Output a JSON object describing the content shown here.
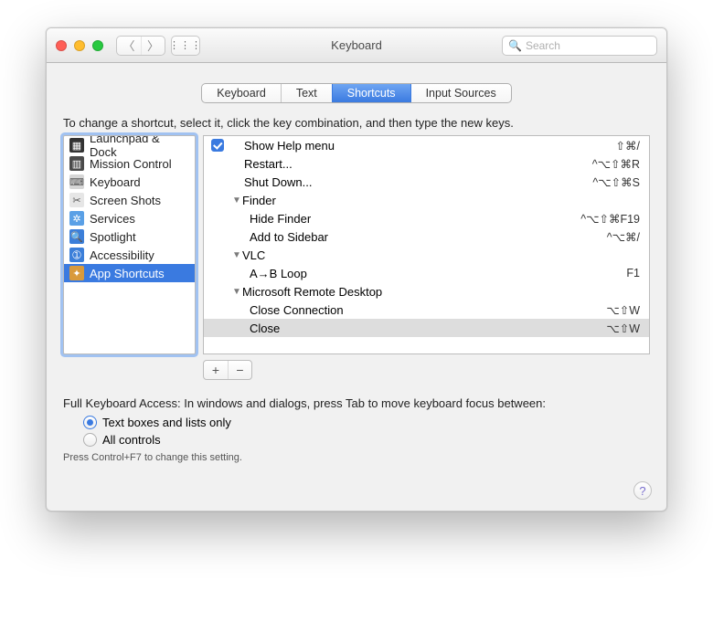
{
  "title": "Keyboard",
  "search": {
    "placeholder": "Search"
  },
  "tabs": [
    "Keyboard",
    "Text",
    "Shortcuts",
    "Input Sources"
  ],
  "instruction": "To change a shortcut, select it, click the key combination, and then type the new keys.",
  "sidebar": {
    "items": [
      {
        "label": "Launchpad & Dock",
        "icon_bg": "#333333",
        "icon_glyph": "▦"
      },
      {
        "label": "Mission Control",
        "icon_bg": "#4a4a4a",
        "icon_glyph": "▥"
      },
      {
        "label": "Keyboard",
        "icon_bg": "#d6d6d6",
        "icon_glyph": "⌨"
      },
      {
        "label": "Screen Shots",
        "icon_bg": "#e6e6e6",
        "icon_glyph": "✂"
      },
      {
        "label": "Services",
        "icon_bg": "#5aa0e6",
        "icon_glyph": "✲"
      },
      {
        "label": "Spotlight",
        "icon_bg": "#3c7fd9",
        "icon_glyph": "🔍"
      },
      {
        "label": "Accessibility",
        "icon_bg": "#3c7fd9",
        "icon_glyph": "➀"
      },
      {
        "label": "App Shortcuts",
        "icon_bg": "#d99a3c",
        "icon_glyph": "✦"
      }
    ]
  },
  "shortcut_rows": [
    {
      "type": "item",
      "checked": true,
      "indent": 0,
      "label": "Show Help menu",
      "key": "⇧⌘/"
    },
    {
      "type": "item",
      "checked": null,
      "indent": 0,
      "label": "Restart...",
      "key": "^⌥⇧⌘R"
    },
    {
      "type": "item",
      "checked": null,
      "indent": 0,
      "label": "Shut Down...",
      "key": "^⌥⇧⌘S"
    },
    {
      "type": "group",
      "label": "Finder"
    },
    {
      "type": "item",
      "checked": null,
      "indent": 2,
      "label": "Hide Finder",
      "key": "^⌥⇧⌘F19"
    },
    {
      "type": "item",
      "checked": null,
      "indent": 2,
      "label": "Add to Sidebar",
      "key": "^⌥⌘/"
    },
    {
      "type": "group",
      "label": "VLC"
    },
    {
      "type": "item",
      "checked": null,
      "indent": 2,
      "label": "A→B Loop",
      "key": "F1"
    },
    {
      "type": "group",
      "label": "Microsoft Remote Desktop"
    },
    {
      "type": "item",
      "checked": null,
      "indent": 2,
      "label": "Close Connection",
      "key": "⌥⇧W"
    },
    {
      "type": "item",
      "checked": null,
      "indent": 2,
      "label": "Close",
      "key": "⌥⇧W",
      "selected": true
    }
  ],
  "pm": {
    "plus": "+",
    "minus": "−"
  },
  "fka": {
    "label": "Full Keyboard Access: In windows and dialogs, press Tab to move keyboard focus between:",
    "opt1": "Text boxes and lists only",
    "opt2": "All controls",
    "hint": "Press Control+F7 to change this setting."
  }
}
